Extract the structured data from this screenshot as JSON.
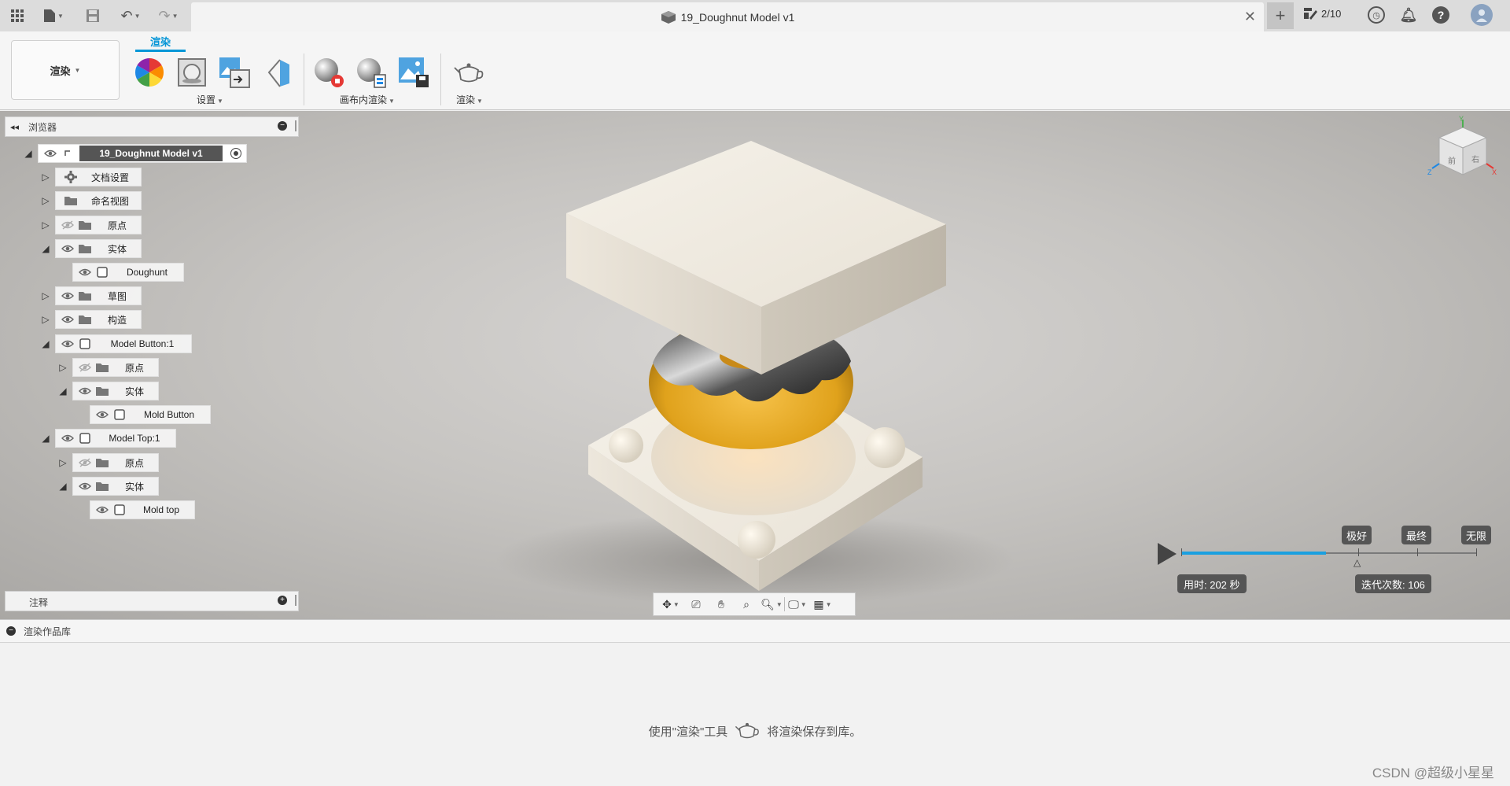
{
  "titlebar": {
    "document_title": "19_Doughnut Model v1",
    "jobs_count": "2/10"
  },
  "ribbon": {
    "workspace_label": "渲染",
    "active_tab": "渲染",
    "groups": {
      "setup": "设置",
      "in_canvas_render": "画布内渲染",
      "render": "渲染"
    }
  },
  "browser": {
    "title": "浏览器",
    "tree": [
      {
        "label": "19_Doughnut Model v1"
      },
      {
        "label": "文档设置"
      },
      {
        "label": "命名视图"
      },
      {
        "label": "原点"
      },
      {
        "label": "实体"
      },
      {
        "label": "Doughunt"
      },
      {
        "label": "草图"
      },
      {
        "label": "构造"
      },
      {
        "label": "Model Button:1"
      },
      {
        "label": "原点"
      },
      {
        "label": "实体"
      },
      {
        "label": "Mold Button"
      },
      {
        "label": "Model Top:1"
      },
      {
        "label": "原点"
      },
      {
        "label": "实体"
      },
      {
        "label": "Mold top"
      }
    ]
  },
  "comments": {
    "title": "注释"
  },
  "render_controls": {
    "quality_levels": [
      "极好",
      "最终",
      "无限"
    ],
    "progress_fraction": 0.49,
    "time_label": "用时: 202 秒",
    "iterations_label": "迭代次数: 106"
  },
  "viewcube": {
    "front": "前",
    "right": "右"
  },
  "gallery": {
    "title": "渲染作品库",
    "hint_before": "使用\"渲染\"工具",
    "hint_after": "将渲染保存到库。"
  },
  "watermark": "CSDN @超级小星星",
  "colors": {
    "accent": "#0696d7",
    "progress": "#1aa0e0",
    "donut_glaze": "#e0a21c",
    "mold": "#f2ece0"
  }
}
